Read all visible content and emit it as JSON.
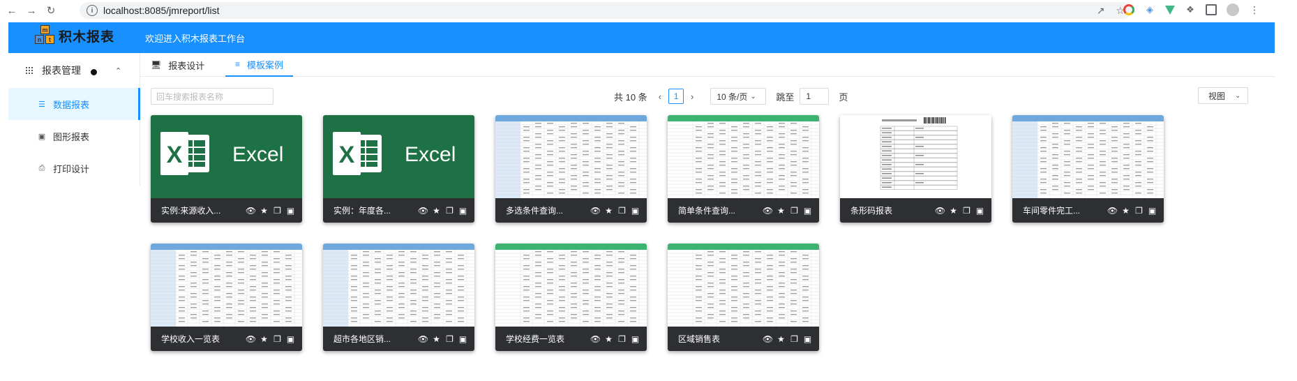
{
  "browser": {
    "url": "localhost:8085/jmreport/list",
    "back_icon": "arrow-left-icon",
    "forward_icon": "arrow-right-icon",
    "reload_icon": "reload-icon"
  },
  "header": {
    "logo_text": "积木报表",
    "welcome": "欢迎进入积木报表工作台"
  },
  "sidebar": {
    "group_label": "报表管理",
    "items": [
      {
        "label": "数据报表",
        "icon": "document-icon",
        "active": true
      },
      {
        "label": "图形报表",
        "icon": "image-icon",
        "active": false
      },
      {
        "label": "打印设计",
        "icon": "printer-icon",
        "active": false
      }
    ]
  },
  "tabs": [
    {
      "label": "报表设计",
      "icon": "monitor-icon",
      "active": false
    },
    {
      "label": "模板案例",
      "icon": "sliders-icon",
      "active": true
    }
  ],
  "search": {
    "placeholder": "回车搜索报表名称"
  },
  "pagination": {
    "total_text": "共 10 条",
    "current_page": "1",
    "page_size": "10 条/页",
    "jump_label": "跳至",
    "jump_value": "1",
    "page_suffix": "页"
  },
  "view": {
    "label": "视图"
  },
  "cards": [
    {
      "title": "实例:来源收入...",
      "thumb": "excel"
    },
    {
      "title": "实例：年度各...",
      "thumb": "excel"
    },
    {
      "title": "多选条件查询...",
      "thumb": "table-blue"
    },
    {
      "title": "简单条件查询...",
      "thumb": "table-green"
    },
    {
      "title": "条形码报表",
      "thumb": "form"
    },
    {
      "title": "车间零件完工...",
      "thumb": "table-blue"
    },
    {
      "title": "学校收入一览表",
      "thumb": "table-blue"
    },
    {
      "title": "超市各地区销...",
      "thumb": "table-blue"
    },
    {
      "title": "学校经费一览表",
      "thumb": "table-green"
    },
    {
      "title": "区域销售表",
      "thumb": "table-green"
    }
  ],
  "excel_label": "Excel",
  "colors": {
    "header": "#1890ff",
    "card_footer": "#2d2f33",
    "excel": "#1e7145"
  }
}
